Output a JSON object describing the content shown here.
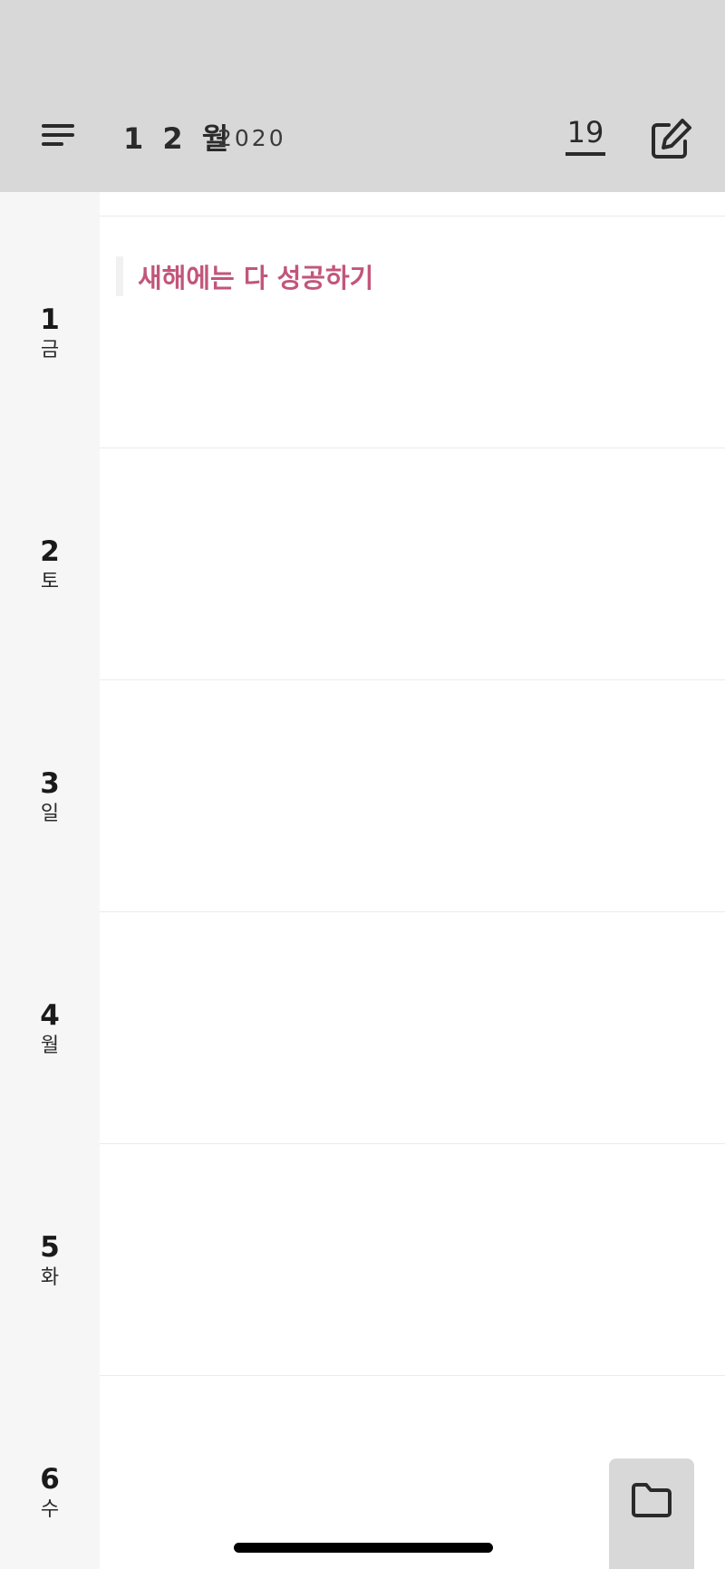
{
  "header": {
    "month": "1 2 월",
    "year": "2020",
    "today_day": "19",
    "menu_icon": "menu-lines-icon",
    "edit_icon": "edit-pencil-icon"
  },
  "days": [
    {
      "num": "1",
      "weekday": "금"
    },
    {
      "num": "2",
      "weekday": "토"
    },
    {
      "num": "3",
      "weekday": "일"
    },
    {
      "num": "4",
      "weekday": "월"
    },
    {
      "num": "5",
      "weekday": "화"
    },
    {
      "num": "6",
      "weekday": "수"
    }
  ],
  "events": [
    {
      "title": "새해에는 다 성공하기",
      "color": "#c2567a",
      "day": "1"
    }
  ],
  "footer": {
    "folder_icon": "folder-icon"
  },
  "colors": {
    "header_bg": "#d8d8d8",
    "gutter_bg": "#f6f6f6",
    "accent": "#c2567a"
  }
}
